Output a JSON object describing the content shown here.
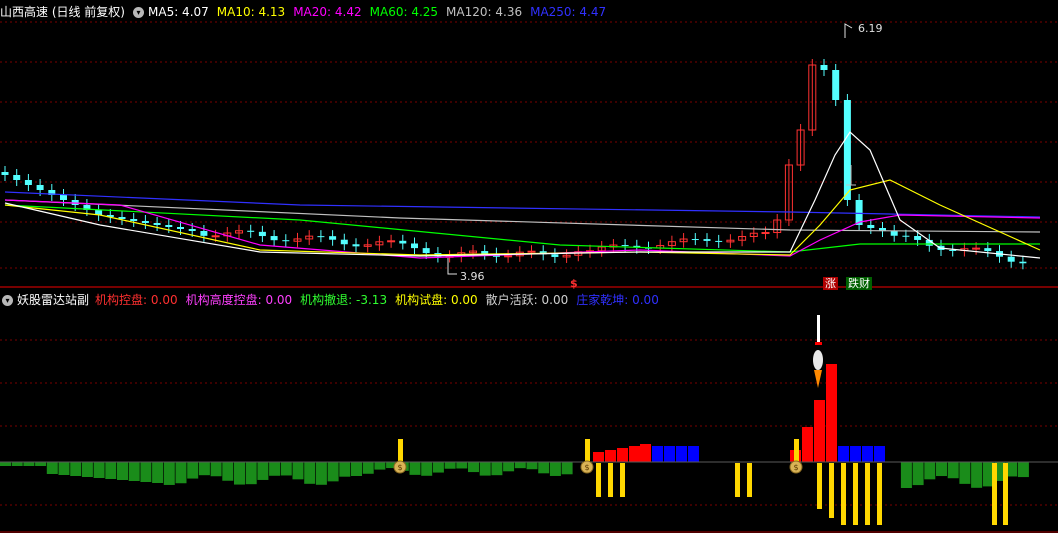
{
  "main_panel": {
    "title": "山西高速 (日线 前复权)",
    "ma_labels": [
      {
        "text": "MA5: 4.07",
        "color": "#ffffff"
      },
      {
        "text": "MA10: 4.13",
        "color": "#ffff00"
      },
      {
        "text": "MA20: 4.42",
        "color": "#ff00ff"
      },
      {
        "text": "MA60: 4.25",
        "color": "#00ff00"
      },
      {
        "text": "MA120: 4.36",
        "color": "#c0c0c0"
      },
      {
        "text": "MA250: 4.47",
        "color": "#3030ff"
      }
    ],
    "high_label": "6.19",
    "low_label": "3.96",
    "tag_rise": "涨",
    "tag_fall": "跌财",
    "dollar_mark": "$"
  },
  "indicator_panel": {
    "title": "妖股雷达站副",
    "labels": [
      {
        "text": "机构控盘: 0.00",
        "color": "#ff3030"
      },
      {
        "text": "机构高度控盘: 0.00",
        "color": "#ff40ff"
      },
      {
        "text": "机构撤退: -3.13",
        "color": "#30ff30"
      },
      {
        "text": "机构试盘: 0.00",
        "color": "#ffff00"
      },
      {
        "text": "散户活跃: 0.00",
        "color": "#d0d0d0"
      },
      {
        "text": "庄家乾坤: 0.00",
        "color": "#3030ff"
      }
    ],
    "money_mark": "$"
  },
  "colors": {
    "up": "#ff3232",
    "down": "#54ffff",
    "grid": "#7a0000",
    "green": "#1a8c1a",
    "red": "#ff0000",
    "blue": "#0000ff",
    "yellow": "#ffd700"
  }
}
